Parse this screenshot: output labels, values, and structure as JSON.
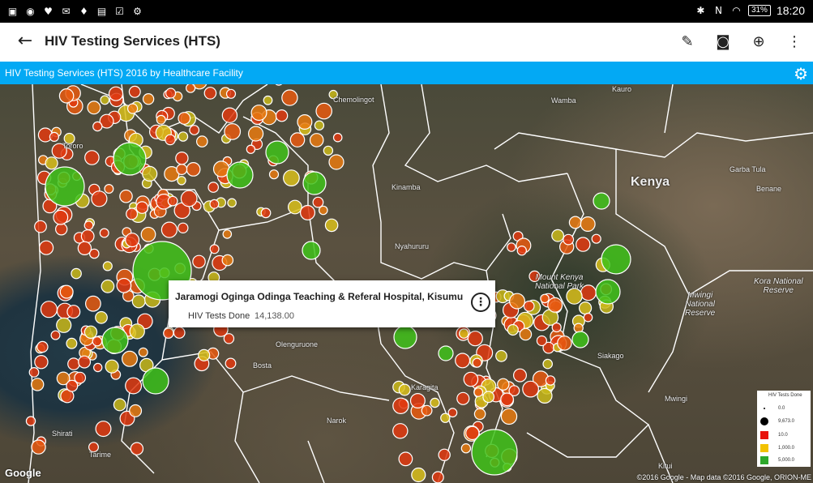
{
  "statusbar": {
    "time": "18:20",
    "battery": "31%"
  },
  "appbar": {
    "title": "HIV Testing Services (HTS)",
    "actions": [
      "pencil-icon",
      "camera-icon",
      "add-location-icon",
      "more-vert-icon"
    ]
  },
  "subbar": {
    "title": "HIV Testing Services (HTS) 2016 by Healthcare Facility"
  },
  "popup": {
    "title": "Jaramogi Oginga Odinga Teaching & Referal Hospital, Kisumu",
    "label": "HIV Tests Done",
    "value": "14,138.00"
  },
  "legend": {
    "title": "HIV Tests Done",
    "items": [
      {
        "label": "0.0",
        "color": "#000000"
      },
      {
        "label": "9,673.0",
        "color": "#000000"
      },
      {
        "label": "10.0",
        "color": "#e8130c"
      },
      {
        "label": "1,000.0",
        "color": "#f2c200"
      },
      {
        "label": "5,000.0",
        "color": "#2ea82b"
      }
    ]
  },
  "places": {
    "tororo": "Tororo",
    "kenya": "Kenya",
    "kinamba": "Kinamba",
    "nyahururu": "Nyahururu",
    "mt_kenya": "Mount Kenya\nNational Park",
    "mwingi": "Mwingi\nNational\nReserve",
    "kora": "Kora National\nReserve",
    "olenguruone": "Olenguruone",
    "bosta": "Bosta",
    "siakago": "Siakago",
    "narok": "Narok",
    "tarime": "Tarime",
    "shirati": "Shirati",
    "kitui": "Kitui",
    "mwingi_town": "Mwingi",
    "garba_tula": "Garba Tula",
    "benane": "Benane",
    "wamba": "Wamba",
    "kauro": "Kauro",
    "chemolingot": "Chemolingot",
    "karagita": "Karagita"
  },
  "attribution": {
    "google": "Google",
    "copyright": "©2016 Google - Map data ©2016 Google, ORION-ME"
  }
}
